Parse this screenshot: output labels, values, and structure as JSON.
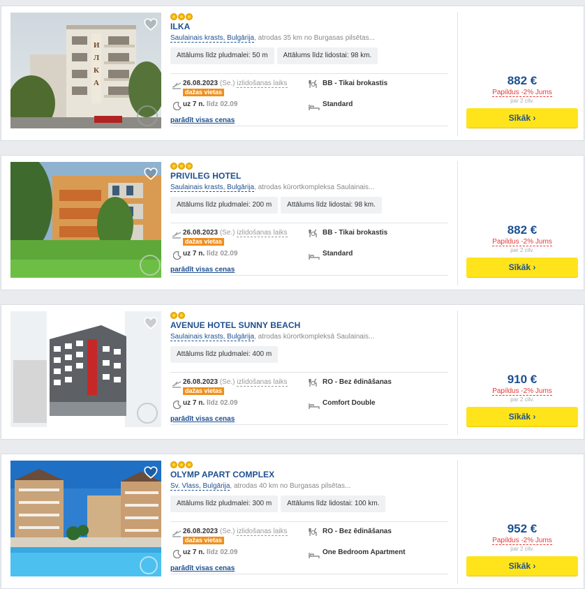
{
  "results": [
    {
      "stars": 3,
      "name": "ILKA",
      "place": "Saulainais krasts, Bulgārija",
      "location_detail": ", atrodas 35 km no Burgasas pilsētas...",
      "distances": [
        "Attālums līdz pludmalei: 50 m",
        "Attālums līdz lidostai: 98 km."
      ],
      "date": "26.08.2023",
      "day": "(Se.)",
      "departure_label": "izlidošanas laiks",
      "availability": "dažas vietas",
      "meal": "BB - Tikai brokastis",
      "nights": "uz 7 n.",
      "until": "līdz 02.09",
      "room": "Standard",
      "all_prices": "parādīt visas cenas",
      "price": "882 €",
      "discount": "Papildus -2% Jums",
      "per": "par 2 cilv.",
      "cta": "Sīkāk ›"
    },
    {
      "stars": 3,
      "name": "PRIVILEG HOTEL",
      "place": "Saulainais krasts, Bulgārija",
      "location_detail": ", atrodas kūrortkompleksa Saulainais...",
      "distances": [
        "Attālums līdz pludmalei: 200 m",
        "Attālums līdz lidostai: 98 km."
      ],
      "date": "26.08.2023",
      "day": "(Se.)",
      "departure_label": "izlidošanas laiks",
      "availability": "dažas vietas",
      "meal": "BB - Tikai brokastis",
      "nights": "uz 7 n.",
      "until": "līdz 02.09",
      "room": "Standard",
      "all_prices": "parādīt visas cenas",
      "price": "882 €",
      "discount": "Papildus -2% Jums",
      "per": "par 2 cilv.",
      "cta": "Sīkāk ›"
    },
    {
      "stars": 2,
      "name": "AVENUE HOTEL SUNNY BEACH",
      "place": "Saulainais krasts, Bulgārija",
      "location_detail": ", atrodas kūrortkompleksā Saulainais...",
      "distances": [
        "Attālums līdz pludmalei: 400 m"
      ],
      "date": "26.08.2023",
      "day": "(Se.)",
      "departure_label": "izlidošanas laiks",
      "availability": "dažas vietas",
      "meal": "RO - Bez ēdināšanas",
      "nights": "uz 7 n.",
      "until": "līdz 02.09",
      "room": "Comfort Double",
      "all_prices": "parādīt visas cenas",
      "price": "910 €",
      "discount": "Papildus -2% Jums",
      "per": "par 2 cilv.",
      "cta": "Sīkāk ›"
    },
    {
      "stars": 3,
      "name": "OLYMP APART COMPLEX",
      "place": "Sv. Vlass, Bulgārija",
      "location_detail": ", atrodas 40 km no Burgasas pilsētas...",
      "distances": [
        "Attālums līdz pludmalei: 300 m",
        "Attālums līdz lidostai: 100 km."
      ],
      "date": "26.08.2023",
      "day": "(Se.)",
      "departure_label": "izlidošanas laiks",
      "availability": "dažas vietas",
      "meal": "RO - Bez ēdināšanas",
      "nights": "uz 7 n.",
      "until": "līdz 02.09",
      "room": "One Bedroom Apartment",
      "all_prices": "parādīt visas cenas",
      "price": "952 €",
      "discount": "Papildus -2% Jums",
      "per": "par 2 cilv.",
      "cta": "Sīkāk ›"
    }
  ],
  "colors": {
    "accent": "#1d4f8f",
    "button": "#ffe41c",
    "badge": "#f0901e",
    "discount": "#e53935",
    "star": "#f5b400"
  }
}
